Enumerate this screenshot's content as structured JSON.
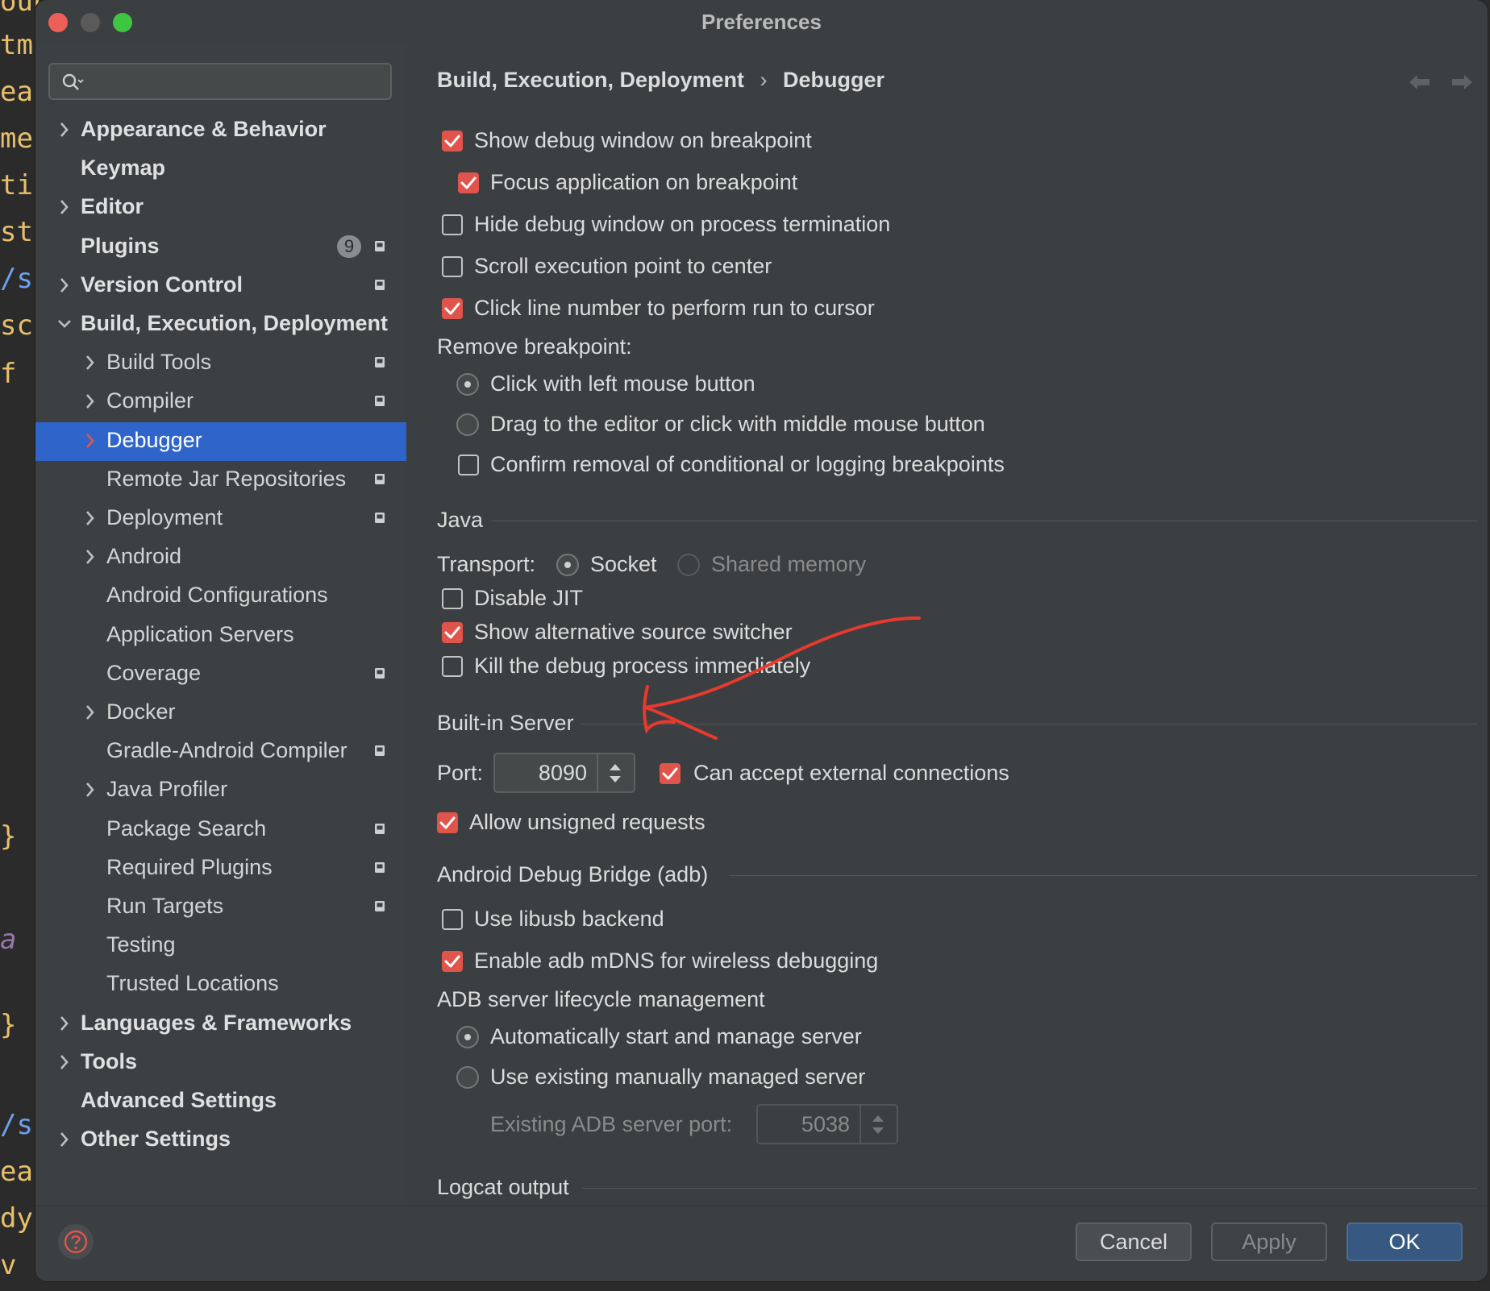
{
  "window": {
    "title": "Preferences"
  },
  "sidebar": {
    "search_placeholder": "",
    "items": [
      {
        "label": "Appearance & Behavior",
        "level": 0,
        "chevron": "right",
        "bold": true,
        "project_icon": false
      },
      {
        "label": "Keymap",
        "level": 0,
        "chevron": "none",
        "bold": true,
        "project_icon": false
      },
      {
        "label": "Editor",
        "level": 0,
        "chevron": "right",
        "bold": true,
        "project_icon": false
      },
      {
        "label": "Plugins",
        "level": 0,
        "chevron": "none",
        "bold": true,
        "project_icon": true,
        "badge": "9"
      },
      {
        "label": "Version Control",
        "level": 0,
        "chevron": "right",
        "bold": true,
        "project_icon": true
      },
      {
        "label": "Build, Execution, Deployment",
        "level": 0,
        "chevron": "down",
        "bold": true,
        "project_icon": false
      },
      {
        "label": "Build Tools",
        "level": 1,
        "chevron": "right",
        "project_icon": true
      },
      {
        "label": "Compiler",
        "level": 1,
        "chevron": "right",
        "project_icon": true
      },
      {
        "label": "Debugger",
        "level": 1,
        "chevron": "right",
        "project_icon": false,
        "selected": true
      },
      {
        "label": "Remote Jar Repositories",
        "level": 1,
        "chevron": "none",
        "project_icon": true
      },
      {
        "label": "Deployment",
        "level": 1,
        "chevron": "right",
        "project_icon": true
      },
      {
        "label": "Android",
        "level": 1,
        "chevron": "right",
        "project_icon": false
      },
      {
        "label": "Android Configurations",
        "level": 1,
        "chevron": "none",
        "project_icon": false
      },
      {
        "label": "Application Servers",
        "level": 1,
        "chevron": "none",
        "project_icon": false
      },
      {
        "label": "Coverage",
        "level": 1,
        "chevron": "none",
        "project_icon": true
      },
      {
        "label": "Docker",
        "level": 1,
        "chevron": "right",
        "project_icon": false
      },
      {
        "label": "Gradle-Android Compiler",
        "level": 1,
        "chevron": "none",
        "project_icon": true
      },
      {
        "label": "Java Profiler",
        "level": 1,
        "chevron": "right",
        "project_icon": false
      },
      {
        "label": "Package Search",
        "level": 1,
        "chevron": "none",
        "project_icon": true
      },
      {
        "label": "Required Plugins",
        "level": 1,
        "chevron": "none",
        "project_icon": true
      },
      {
        "label": "Run Targets",
        "level": 1,
        "chevron": "none",
        "project_icon": true
      },
      {
        "label": "Testing",
        "level": 1,
        "chevron": "none",
        "project_icon": false
      },
      {
        "label": "Trusted Locations",
        "level": 1,
        "chevron": "none",
        "project_icon": false
      },
      {
        "label": "Languages & Frameworks",
        "level": 0,
        "chevron": "right",
        "bold": true,
        "project_icon": false
      },
      {
        "label": "Tools",
        "level": 0,
        "chevron": "right",
        "bold": true,
        "project_icon": false
      },
      {
        "label": "Advanced Settings",
        "level": 0,
        "chevron": "none",
        "bold": true,
        "project_icon": false
      },
      {
        "label": "Other Settings",
        "level": 0,
        "chevron": "right",
        "bold": true,
        "project_icon": false
      }
    ]
  },
  "breadcrumb": {
    "parent": "Build, Execution, Deployment",
    "separator": "›",
    "current": "Debugger"
  },
  "general": {
    "show_debug_window": {
      "label": "Show debug window on breakpoint",
      "checked": true
    },
    "focus_application": {
      "label": "Focus application on breakpoint",
      "checked": true
    },
    "hide_debug_window": {
      "label": "Hide debug window on process termination",
      "checked": false
    },
    "scroll_execution_point": {
      "label": "Scroll execution point to center",
      "checked": false
    },
    "click_line_number": {
      "label": "Click line number to perform run to cursor",
      "checked": true
    },
    "remove_breakpoint_label": "Remove breakpoint:",
    "remove_left_click": {
      "label": "Click with left mouse button",
      "selected": true
    },
    "remove_drag": {
      "label": "Drag to the editor or click with middle mouse button",
      "selected": false
    },
    "confirm_removal": {
      "label": "Confirm removal of conditional or logging breakpoints",
      "checked": false
    }
  },
  "java": {
    "title": "Java",
    "transport_label": "Transport:",
    "socket": {
      "label": "Socket",
      "selected": true
    },
    "shared_memory": {
      "label": "Shared memory",
      "selected": false,
      "enabled": false
    },
    "disable_jit": {
      "label": "Disable JIT",
      "checked": false
    },
    "alt_source_switcher": {
      "label": "Show alternative source switcher",
      "checked": true
    },
    "kill_debug_process": {
      "label": "Kill the debug process immediately",
      "checked": false
    }
  },
  "builtin_server": {
    "title": "Built-in Server",
    "port_label": "Port:",
    "port_value": "8090",
    "accept_external": {
      "label": "Can accept external connections",
      "checked": true
    },
    "allow_unsigned": {
      "label": "Allow unsigned requests",
      "checked": true
    }
  },
  "adb": {
    "title": "Android Debug Bridge (adb)",
    "use_libusb": {
      "label": "Use libusb backend",
      "checked": false
    },
    "enable_mdns": {
      "label": "Enable adb mDNS for wireless debugging",
      "checked": true
    },
    "lifecycle_label": "ADB server lifecycle management",
    "auto_start": {
      "label": "Automatically start and manage server",
      "selected": true
    },
    "use_existing": {
      "label": "Use existing manually managed server",
      "selected": false
    },
    "existing_port_label": "Existing ADB server port:",
    "existing_port_value": "5038"
  },
  "logcat": {
    "title": "Logcat output"
  },
  "footer": {
    "cancel": "Cancel",
    "apply": "Apply",
    "ok": "OK",
    "help_icon": "question-circle-icon"
  },
  "colors": {
    "accent_checkbox": "#e0544c",
    "selection": "#2f65ca",
    "annotation": "#e8392e",
    "ok_button": "#365881"
  }
}
